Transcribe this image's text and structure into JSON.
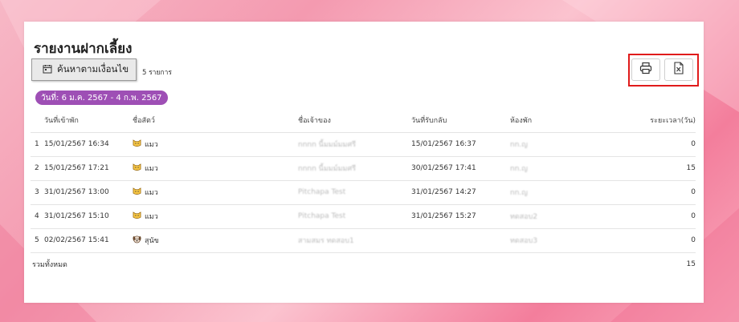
{
  "report": {
    "title": "รายงานฝากเลี้ยง",
    "search_label": "ค้นหาตามเงื่อนไข",
    "count_text": "5 รายการ",
    "date_range": "วันที่: 6 ม.ค. 2567 - 4 ก.พ. 2567"
  },
  "toolbar": {
    "print_icon": "printer-icon",
    "excel_icon": "excel-file-icon",
    "highlight_color": "#e01b1b"
  },
  "table": {
    "headers": [
      "วันที่เข้าพัก",
      "ชื่อสัตว์",
      "ชื่อเจ้าของ",
      "วันที่รับกลับ",
      "ห้องพัก",
      "ระยะเวลา(วัน)"
    ],
    "rows": [
      {
        "no": "1",
        "check_in": "15/01/2567 16:34",
        "pet_icon": "cat-icon",
        "pet": "แมว",
        "owner": "nnnn นี้มมม์มมศรี",
        "check_out": "15/01/2567 16:37",
        "room": "nn.ญ",
        "days": "0"
      },
      {
        "no": "2",
        "check_in": "15/01/2567 17:21",
        "pet_icon": "cat-icon",
        "pet": "แมว",
        "owner": "nnnn นี้มมม์มมศรี",
        "check_out": "30/01/2567 17:41",
        "room": "nn.ญ",
        "days": "15"
      },
      {
        "no": "3",
        "check_in": "31/01/2567 13:00",
        "pet_icon": "cat-icon",
        "pet": "แมว",
        "owner": "Pitchapa Test",
        "check_out": "31/01/2567 14:27",
        "room": "nn.ญ",
        "days": "0"
      },
      {
        "no": "4",
        "check_in": "31/01/2567 15:10",
        "pet_icon": "cat-icon",
        "pet": "แมว",
        "owner": "Pitchapa Test",
        "check_out": "31/01/2567 15:27",
        "room": "ทดสอบ2",
        "days": "0"
      },
      {
        "no": "5",
        "check_in": "02/02/2567 15:41",
        "pet_icon": "dog-icon",
        "pet": "สุนัข",
        "owner": "สามสมร ทดสอบ1",
        "check_out": "",
        "room": "ทดสอบ3",
        "days": "0"
      }
    ],
    "total_label": "รวมทั้งหมด",
    "total_days": "15"
  }
}
